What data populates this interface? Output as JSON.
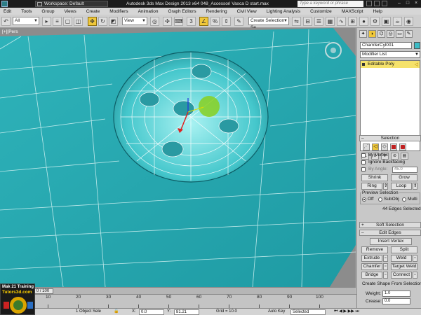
{
  "titlebar": {
    "workspace": "Workspace: Default",
    "title": "Autodesk 3ds Max Design 2013 x64     048_Accessori Vasca D start.max",
    "search_placeholder": "Type a keyword or phrase"
  },
  "menu": [
    "Edit",
    "Tools",
    "Group",
    "Views",
    "Create",
    "Modifiers",
    "Animation",
    "Graph Editors",
    "Rendering",
    "Civil View",
    "Lighting Analysis",
    "Customize",
    "MAXScript",
    "Help"
  ],
  "toolbar": {
    "selection_filter": "All",
    "ref_coord": "View",
    "named_selection_placeholder": "Create Selection Se"
  },
  "viewport": {
    "label": "[+][Pers"
  },
  "command_panel": {
    "object_name": "ChamferCyl001",
    "object_color": "#3cbcc6",
    "modifier_list": "Modifier List",
    "stack_item": "Editable Poly",
    "selection": {
      "header": "Selection",
      "by_vertex": "By Vertex",
      "ignore_backfacing": "Ignore Backfacing",
      "by_angle": "By Angle:",
      "angle_value": "45.0",
      "shrink": "Shrink",
      "grow": "Grow",
      "ring": "Ring",
      "loop": "Loop",
      "preview_label": "Preview Selection",
      "preview_off": "Off",
      "preview_subobj": "SubObj",
      "preview_multi": "Multi",
      "status": "44 Edges Selected"
    },
    "soft_selection": {
      "header": "Soft Selection"
    },
    "edit_edges": {
      "header": "Edit Edges",
      "insert_vertex": "Insert Vertex",
      "remove": "Remove",
      "split": "Split",
      "extrude": "Extrude",
      "weld": "Weld",
      "chamfer": "Chamfer",
      "target_weld": "Target Weld",
      "bridge": "Bridge",
      "connect": "Connect",
      "create_shape": "Create Shape From Selection",
      "weight_label": "Weight:",
      "weight_value": "1.0",
      "crease_label": "Crease:",
      "crease_value": "0.0"
    }
  },
  "timeline": {
    "thumb": "0 / 100",
    "ticks": [
      "10",
      "20",
      "30",
      "40",
      "50",
      "60",
      "70",
      "80",
      "90",
      "100"
    ]
  },
  "status": {
    "objects": "1 Object Sele",
    "x": "0.0",
    "y": "81.21",
    "grid": "Grid = 10.0",
    "autokey": "Auto Key",
    "selected": "Selected"
  },
  "logo": {
    "line1": "Mak 21 Training",
    "line2": "Tutors3d.com"
  }
}
